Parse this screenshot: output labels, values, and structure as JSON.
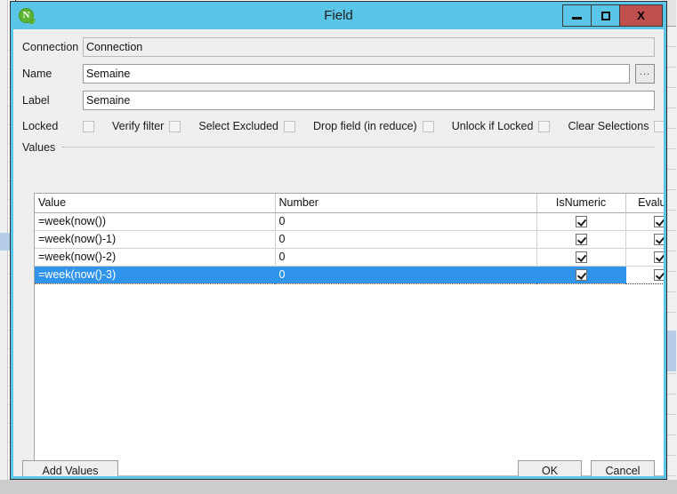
{
  "window": {
    "title": "Field",
    "icon": "qlik-n-icon",
    "icon_letter": "N",
    "titlebar_color": "#5bc5e8",
    "close_color": "#c0504d",
    "controls": {
      "minimize": "minimize-icon",
      "maximize": "maximize-icon",
      "close": "X"
    }
  },
  "form": {
    "connection": {
      "label": "Connection",
      "value": "Connection"
    },
    "name": {
      "label": "Name",
      "value": "Semaine",
      "browse_label": "..."
    },
    "label_field": {
      "label": "Label",
      "value": "Semaine"
    },
    "options": [
      {
        "label": "Locked",
        "checked": false
      },
      {
        "label": "Verify filter",
        "checked": false
      },
      {
        "label": "Select Excluded",
        "checked": false
      },
      {
        "label": "Drop field (in reduce)",
        "checked": false
      },
      {
        "label": "Unlock if Locked",
        "checked": false
      },
      {
        "label": "Clear Selections",
        "checked": false
      }
    ]
  },
  "values_group": {
    "title": "Values",
    "columns": [
      "Value",
      "Number",
      "IsNumeric",
      "Evaluate"
    ],
    "rows": [
      {
        "value": "=week(now())",
        "number": "0",
        "isnumeric": true,
        "evaluate": true,
        "selected": false
      },
      {
        "value": "=week(now()-1)",
        "number": "0",
        "isnumeric": true,
        "evaluate": true,
        "selected": false
      },
      {
        "value": "=week(now()-2)",
        "number": "0",
        "isnumeric": true,
        "evaluate": true,
        "selected": false
      },
      {
        "value": "=week(now()-3)",
        "number": "0",
        "isnumeric": true,
        "evaluate": true,
        "selected": true
      }
    ],
    "toolbar": {
      "add": "+",
      "remove": "–",
      "confirm": "✔",
      "cancel": "✖"
    },
    "scrollbar": {
      "left_arrow": "‹",
      "right_arrow": "›"
    },
    "selection_color": "#2f94ea"
  },
  "footer": {
    "add_values": "Add Values",
    "ok": "OK",
    "cancel": "Cancel"
  }
}
